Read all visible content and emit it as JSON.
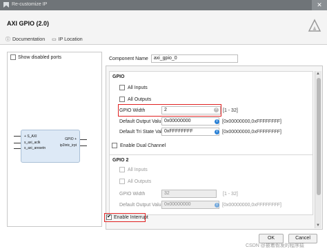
{
  "window": {
    "title": "Re-customize IP",
    "close_glyph": "✕"
  },
  "header": {
    "ip_name": "AXI GPIO (2.0)",
    "links": [
      {
        "icon": "info-icon",
        "label": "Documentation"
      },
      {
        "icon": "folder-icon",
        "label": "IP Location"
      }
    ]
  },
  "symbol": {
    "show_disabled_ports_label": "Show disabled ports",
    "show_disabled_ports_checked": false,
    "ports_left": [
      "S_AXI",
      "s_axi_aclk",
      "s_axi_aresetn"
    ],
    "ports_right": [
      "GPIO",
      "ip2intc_irpt"
    ]
  },
  "component": {
    "label": "Component Name",
    "value": "axi_gpio_0"
  },
  "gpio": {
    "title": "GPIO",
    "all_inputs": {
      "label": "All Inputs",
      "checked": false
    },
    "all_outputs": {
      "label": "All Outputs",
      "checked": false
    },
    "width": {
      "label": "GPIO Width",
      "value": "2",
      "range": "[1 - 32]"
    },
    "default_output": {
      "label": "Default Output Value",
      "value": "0x00000000",
      "range": "[0x00000000,0xFFFFFFFF]"
    },
    "default_tristate": {
      "label": "Default Tri State Value",
      "value": "0xFFFFFFFF",
      "range": "[0x00000000,0xFFFFFFFF]"
    },
    "dual_channel": {
      "label": "Enable Dual Channel",
      "checked": false
    }
  },
  "gpio2": {
    "title": "GPIO 2",
    "all_inputs": {
      "label": "All Inputs",
      "checked": false
    },
    "all_outputs": {
      "label": "All Outputs",
      "checked": false
    },
    "width": {
      "label": "GPIO Width",
      "value": "32",
      "range": "[1 - 32]"
    },
    "default_output": {
      "label": "Default Output Value",
      "value": "0x00000000",
      "range": "[0x00000000,0xFFFFFFFF]"
    }
  },
  "interrupt": {
    "label": "Enable Interrupt",
    "checked": true
  },
  "buttons": {
    "ok": "OK",
    "cancel": "Cancel"
  },
  "watermark": "CSDN @披着假发的程序猿",
  "colors": {
    "highlight": "#e02020",
    "info": "#2c82d6",
    "block_fill": "#dde9f6"
  }
}
